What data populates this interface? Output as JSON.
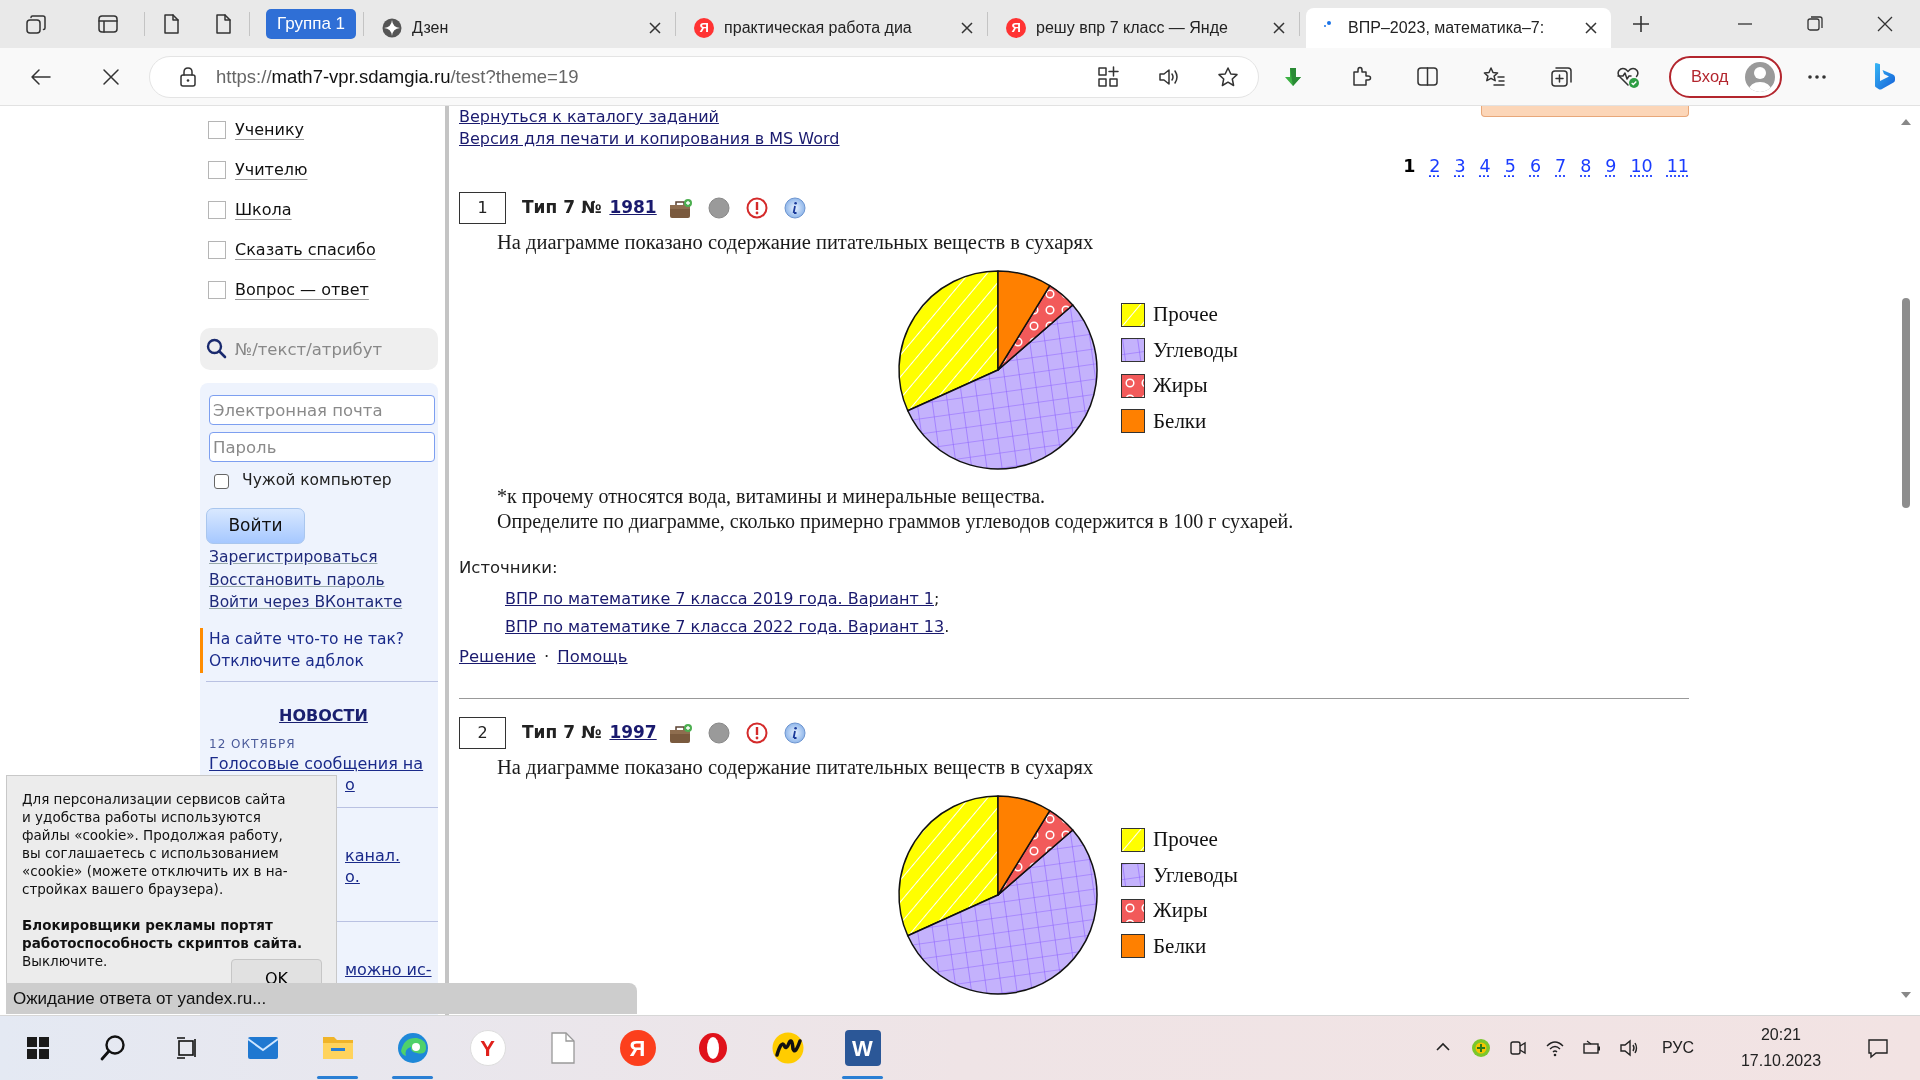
{
  "browser": {
    "tab_group": {
      "label": "Группа 1"
    },
    "tabs": [
      {
        "label": "Дзен",
        "kind": "dzen",
        "selected": false
      },
      {
        "label": "практическая работа диа",
        "kind": "letter",
        "glyph": "Я",
        "selected": false
      },
      {
        "label": "решу впр 7 класс — Янде",
        "kind": "letter",
        "glyph": "Я",
        "selected": false
      },
      {
        "label": "ВПР–2023, математика–7:",
        "kind": "loading",
        "selected": true
      }
    ],
    "url": {
      "scheme": "https://",
      "host": "math7-vpr.sdamgia.ru",
      "path": "/test?theme=19"
    },
    "profile_button": "Вход"
  },
  "sidebar": {
    "menu": [
      {
        "label": "Ученику",
        "checked": false
      },
      {
        "label": "Учителю",
        "checked": false
      },
      {
        "label": "Школа",
        "checked": false
      },
      {
        "label": "Сказать спасибо",
        "checked": false
      },
      {
        "label": "Вопрос — ответ",
        "checked": false
      }
    ],
    "search": {
      "placeholder": "№/текст/атрибут"
    },
    "login": {
      "email_placeholder": "Электронная почта",
      "password_placeholder": "Пароль",
      "remember": {
        "label": "Чужой компьютер",
        "checked": false
      },
      "button": "Войти",
      "links": [
        "Зарегистрироваться",
        "Восстановить пароль",
        "Войти через ВКонтакте"
      ]
    },
    "notice": [
      "На сайте что-то не так?",
      "Отключите адблок"
    ],
    "news": {
      "heading": "НОВОСТИ",
      "items": [
        {
          "date": "12 ОКТЯБРЯ",
          "lines": [
            "Голосовые сообщения на",
            "о"
          ]
        },
        {
          "lines": [
            "канал.",
            "о."
          ]
        },
        {
          "lines": [
            "можно ис-"
          ]
        }
      ]
    }
  },
  "page": {
    "top_links": [
      "Вернуться к каталогу заданий",
      "Версия для печати и копирования в MS Word"
    ],
    "pagination": [
      {
        "label": "1",
        "selected": true
      },
      {
        "label": "2",
        "selected": false
      },
      {
        "label": "3",
        "selected": false
      },
      {
        "label": "4",
        "selected": false
      },
      {
        "label": "5",
        "selected": false
      },
      {
        "label": "6",
        "selected": false
      },
      {
        "label": "7",
        "selected": false
      },
      {
        "label": "8",
        "selected": false
      },
      {
        "label": "9",
        "selected": false
      },
      {
        "label": "10",
        "selected": false
      },
      {
        "label": "11",
        "selected": false
      }
    ],
    "problems": [
      {
        "number": "1",
        "type": "Тип 7 №",
        "id": "1981",
        "question": "На диаграмме показано содержание питательных веществ в сухарях",
        "legend": [
          {
            "label": "Прочее",
            "color": "#ffff00"
          },
          {
            "label": "Углеводы",
            "color": "#c4b2fc"
          },
          {
            "label": "Жиры",
            "color": "#f25a5a"
          },
          {
            "label": "Белки",
            "color": "#ff8000"
          }
        ],
        "notes": [
          "*к прочему относятся вода, витамины и минеральные вещества.",
          "Определите по диаграмме, сколько примерно граммов углеводов содержится в 100 г сухарей."
        ],
        "sources_label": "Источники:",
        "sources": [
          {
            "text": "ВПР по математике 7 класса 2019 года. Вариант 1",
            "suffix": ";"
          },
          {
            "text": "ВПР по математике 7 класса 2022 года. Вариант 13",
            "suffix": "."
          }
        ],
        "actions": [
          "Решение",
          "Помощь"
        ],
        "separator": "·"
      },
      {
        "number": "2",
        "type": "Тип 7 №",
        "id": "1997",
        "question": "На диаграмме показано содержание питательных веществ в сухарях",
        "legend": [
          {
            "label": "Прочее",
            "color": "#ffff00"
          },
          {
            "label": "Углеводы",
            "color": "#c4b2fc"
          },
          {
            "label": "Жиры",
            "color": "#f25a5a"
          },
          {
            "label": "Белки",
            "color": "#ff8000"
          }
        ]
      }
    ]
  },
  "cookie_notice": {
    "text": "Для персонализации сервисов сайта\nи удобства работы используются\nфайлы «cookie». Продолжая работу,\nвы соглашаетесь с использованием\n«cookie» (можете отключить их в на-\nстройках вашего браузера).",
    "warning": "**Блокировщики рекламы портят работоспособность скриптов сайта.** Выключите.",
    "button": "OK"
  },
  "status_bar": "Ожидание ответа от yandex.ru...",
  "taskbar": {
    "apps": [
      {
        "running": false
      },
      {
        "running": false
      },
      {
        "running": false
      },
      {
        "running": false
      },
      {
        "running": true
      },
      {
        "running": true
      },
      {
        "glyph": "Y",
        "running": false
      },
      {
        "running": false
      },
      {
        "glyph": "Я",
        "running": false
      },
      {
        "running": false
      },
      {
        "running": false
      },
      {
        "glyph": "W",
        "running": true
      }
    ],
    "language": "РУС",
    "time": "20:21",
    "date": "17.10.2023"
  }
}
